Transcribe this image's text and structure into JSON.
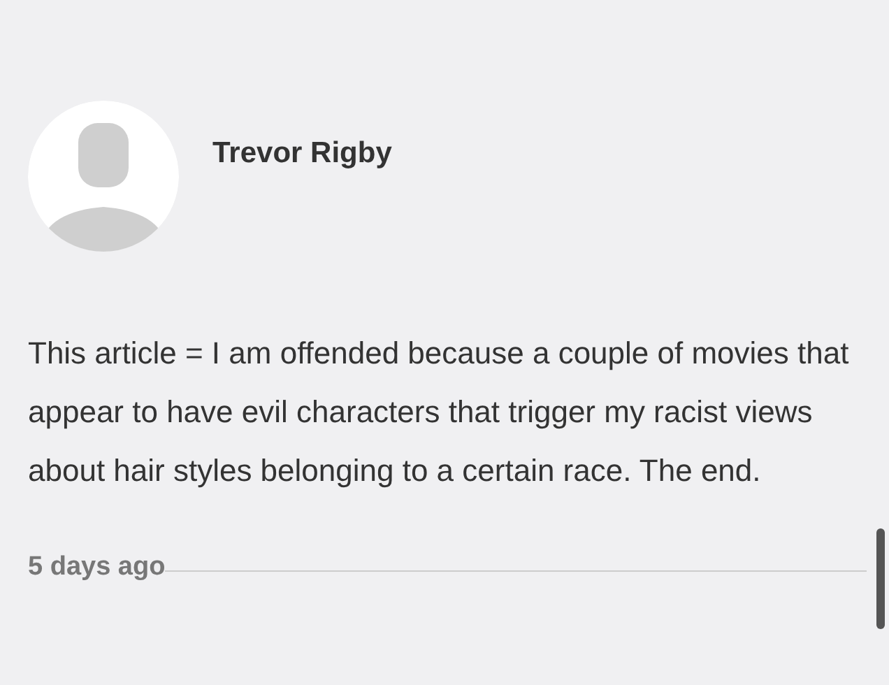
{
  "comment": {
    "author": "Trevor Rigby",
    "text": "This article = I am offended because a couple of movies that appear to have evil characters that trigger my racist views about hair styles belonging to a certain race. The end.",
    "time": "5 days ago"
  }
}
